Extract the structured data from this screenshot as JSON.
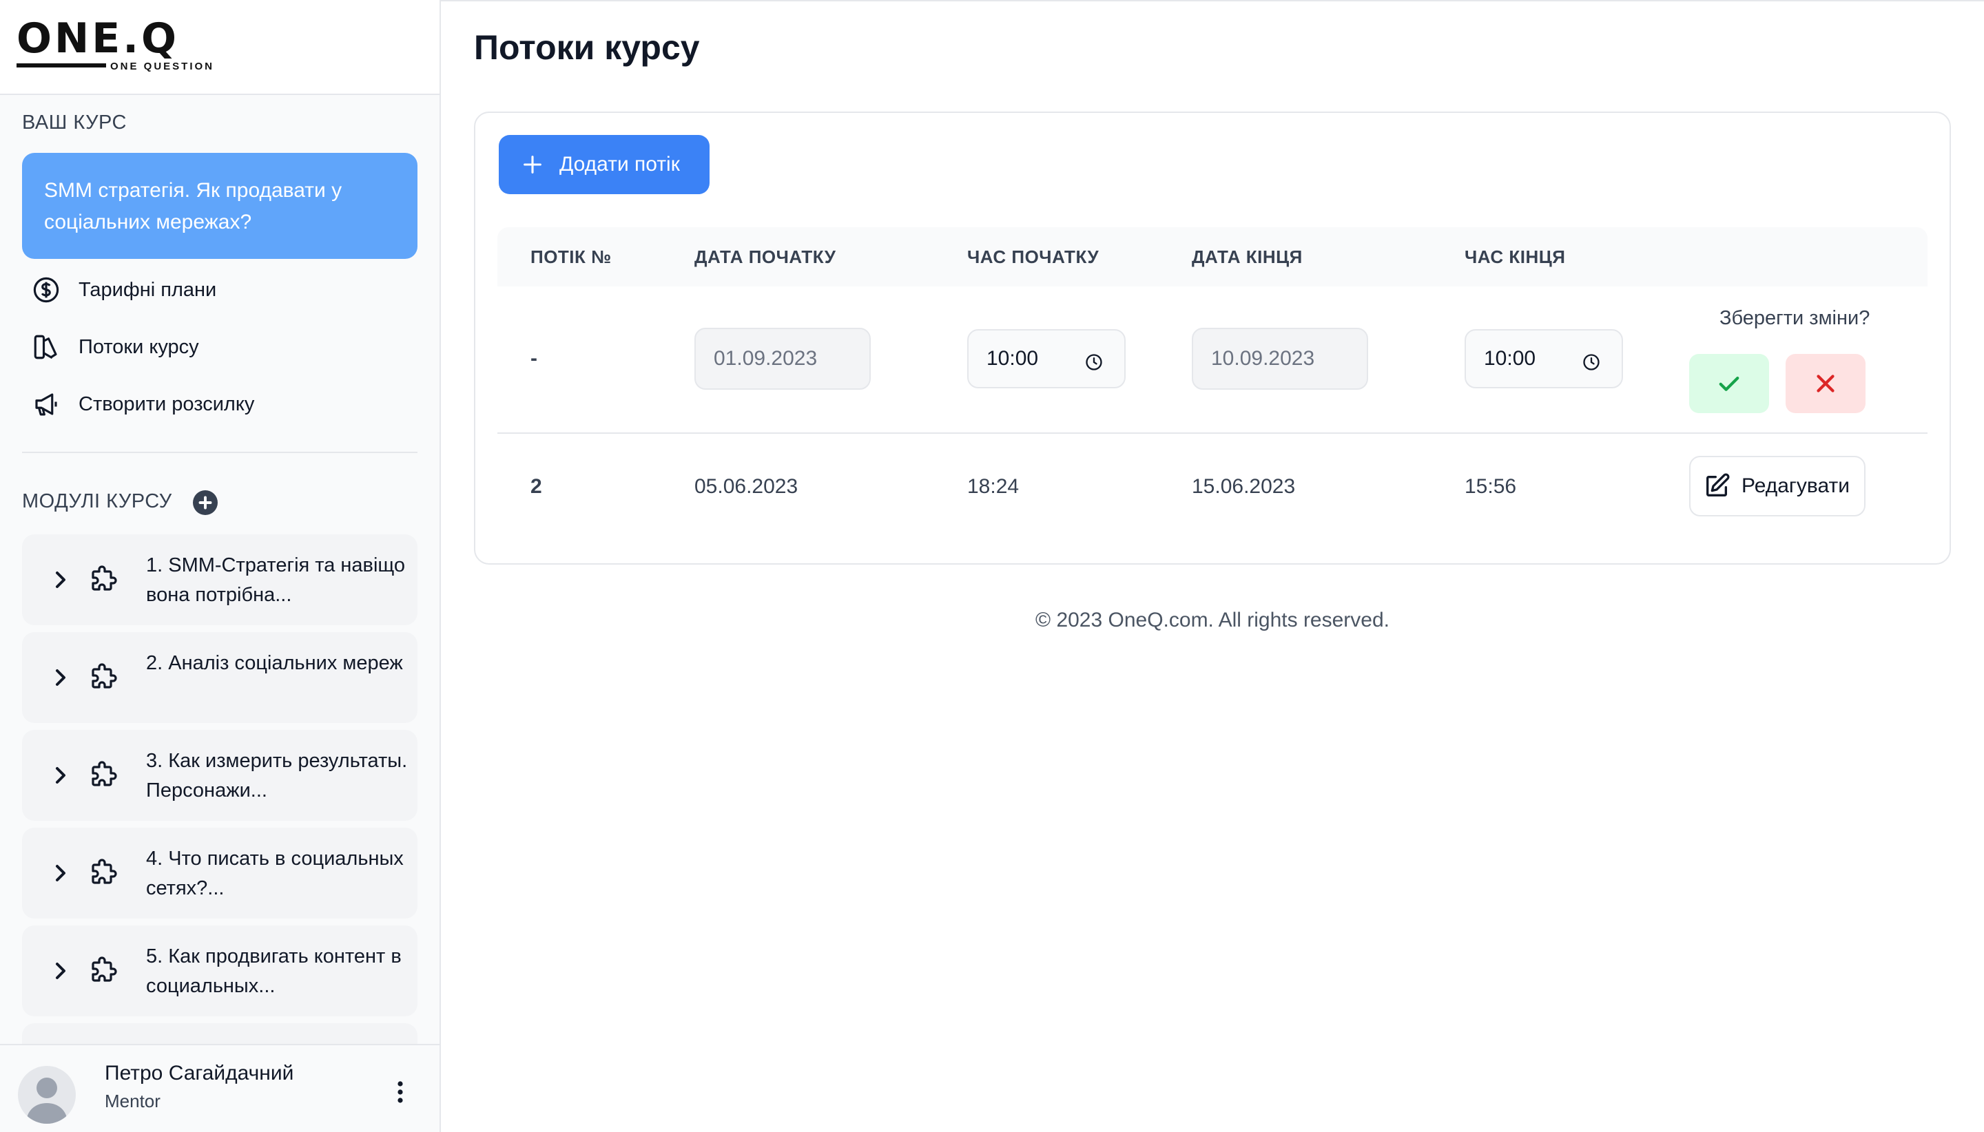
{
  "brand": {
    "name": "ONE.Q",
    "tagline": "ONE QUESTION"
  },
  "sidebar": {
    "course_section_title": "ВАШ КУРС",
    "course_title": "SMM стратегія. Як продавати у соціальних мережах?",
    "nav": [
      {
        "label": "Тарифні плани",
        "icon": "dollar-circle-icon"
      },
      {
        "label": "Потоки курсу",
        "icon": "streams-icon"
      },
      {
        "label": "Створити розсилку",
        "icon": "megaphone-icon"
      }
    ],
    "modules_title": "МОДУЛІ КУРСУ",
    "modules": [
      {
        "label": "1. SMM-Стратегія та навіщо вона потрібна..."
      },
      {
        "label": "2. Аналіз соціальних мереж"
      },
      {
        "label": "3. Как измерить результаты. Персонажи..."
      },
      {
        "label": "4. Что писать в социальных сетях?..."
      },
      {
        "label": "5. Как продвигать контент в социальных..."
      }
    ],
    "user": {
      "name": "Петро Сагайдачний",
      "role": "Mentor"
    }
  },
  "main": {
    "title": "Потоки курсу",
    "add_button": "Додати потік",
    "columns": [
      "ПОТІК №",
      "ДАТА ПОЧАТКУ",
      "ЧАС ПОЧАТКУ",
      "ДАТА КІНЦЯ",
      "ЧАС КІНЦЯ"
    ],
    "edit_row": {
      "number": "-",
      "start_date": "01.09.2023",
      "start_time": "10:00",
      "end_date": "10.09.2023",
      "end_time": "10:00",
      "save_prompt": "Зберегти зміни?"
    },
    "rows": [
      {
        "number": "2",
        "start_date": "05.06.2023",
        "start_time": "18:24",
        "end_date": "15.06.2023",
        "end_time": "15:56",
        "action": "Редагувати"
      }
    ]
  },
  "footer": {
    "text": "© 2023 OneQ.com. All rights reserved."
  },
  "colors": {
    "accent": "#3b82f6",
    "course_card": "#60a5fa",
    "confirm_bg": "#dcfce7",
    "confirm_icon": "#16a34a",
    "cancel_bg": "#fee2e2",
    "cancel_icon": "#dc2626"
  }
}
